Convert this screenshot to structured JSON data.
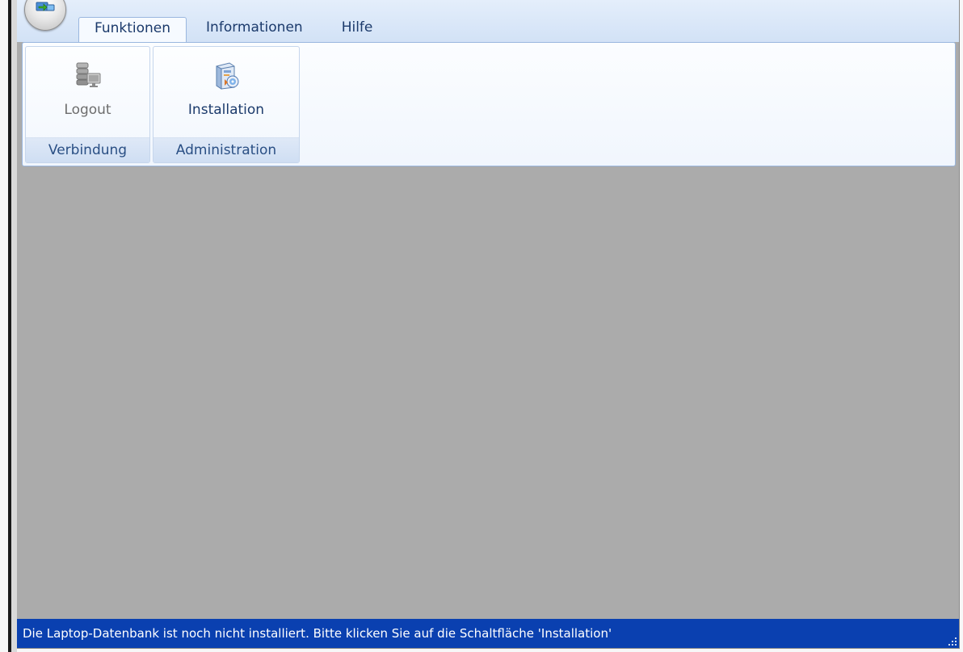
{
  "tabs": [
    {
      "label": "Funktionen",
      "active": true
    },
    {
      "label": "Informationen",
      "active": false
    },
    {
      "label": "Hilfe",
      "active": false
    }
  ],
  "ribbon": {
    "groups": [
      {
        "caption": "Verbindung",
        "button": {
          "label": "Logout",
          "icon": "server-computer-icon",
          "enabled": false
        }
      },
      {
        "caption": "Administration",
        "button": {
          "label": "Installation",
          "icon": "installer-package-icon",
          "enabled": true
        }
      }
    ]
  },
  "statusbar": {
    "message": "Die Laptop-Datenbank ist noch nicht installiert. Bitte klicken Sie auf die Schaltfläche 'Installation'"
  },
  "colors": {
    "statusbar_bg": "#0a40b0",
    "workspace_bg": "#ababab",
    "ribbon_border": "#9ab7df",
    "tab_text": "#1b3a6b"
  }
}
